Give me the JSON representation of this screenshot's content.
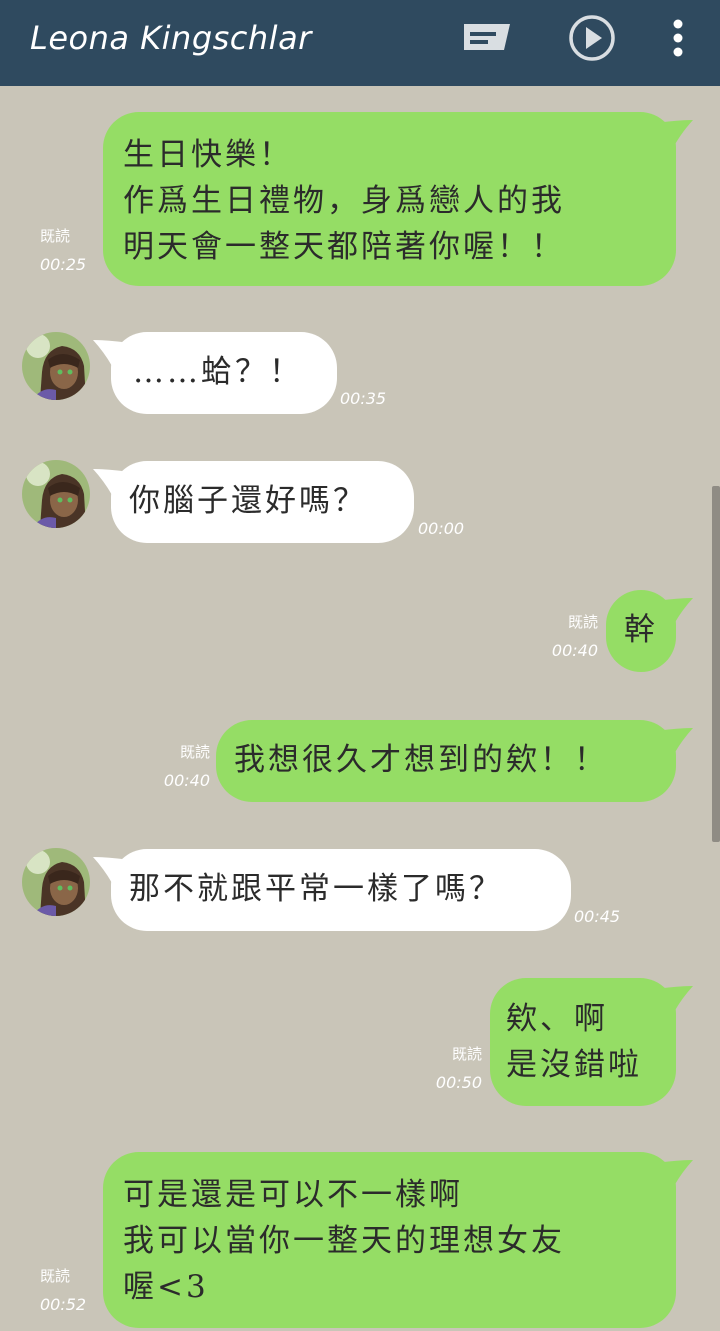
{
  "header": {
    "title": "Leona Kingschlar",
    "icons": [
      "keyboard-icon",
      "play-icon",
      "more-vert-icon"
    ]
  },
  "colors": {
    "header_bg": "#2f4a5f",
    "chat_bg": "#c9c5b8",
    "sent_bubble": "#95dd65",
    "received_bubble": "#ffffff"
  },
  "messages": [
    {
      "from": "me",
      "text": "生日快樂！\n作爲生日禮物，身爲戀人的我\n明天會一整天都陪著你喔！！",
      "read": "既読",
      "time": "00:25"
    },
    {
      "from": "them",
      "text": "……蛤？！",
      "time": "00:35"
    },
    {
      "from": "them",
      "text": "你腦子還好嗎？",
      "time": "00:00"
    },
    {
      "from": "me",
      "text": "幹",
      "read": "既読",
      "time": "00:40"
    },
    {
      "from": "me",
      "text": "我想很久才想到的欸！！",
      "read": "既読",
      "time": "00:40"
    },
    {
      "from": "them",
      "text": "那不就跟平常一樣了嗎？",
      "time": "00:45"
    },
    {
      "from": "me",
      "text": "欸、啊\n是沒錯啦",
      "read": "既読",
      "time": "00:50"
    },
    {
      "from": "me",
      "text": "可是還是可以不一樣啊\n我可以當你一整天的理想女友\n喔<3",
      "read": "既読",
      "time": "00:52"
    }
  ]
}
